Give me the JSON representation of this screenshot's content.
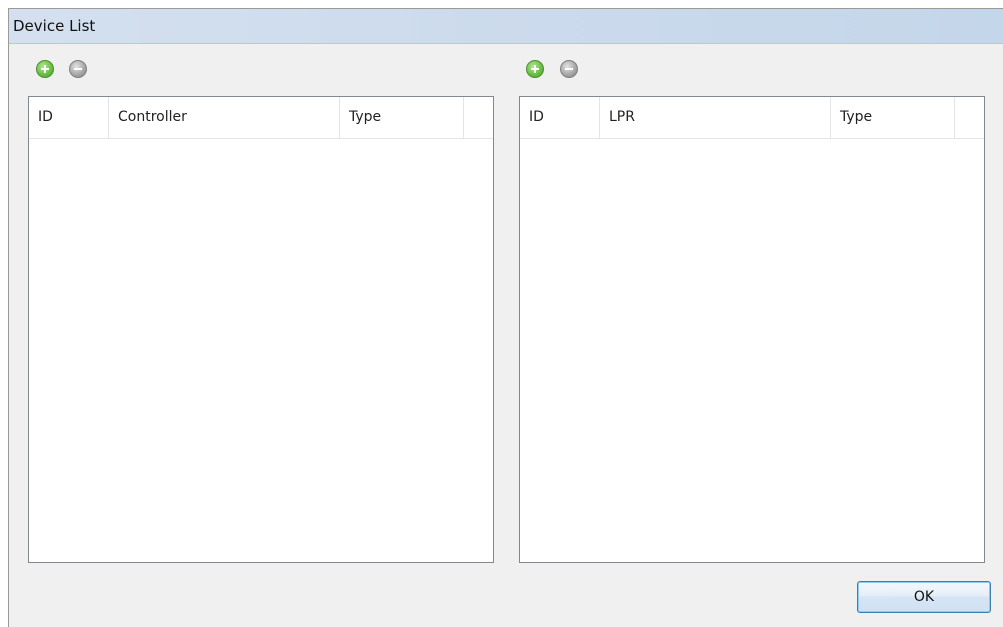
{
  "window": {
    "title": "Device List"
  },
  "left_panel": {
    "columns": [
      "ID",
      "Controller",
      "Type"
    ],
    "rows": []
  },
  "right_panel": {
    "columns": [
      "ID",
      "LPR",
      "Type"
    ],
    "rows": []
  },
  "icons": {
    "add": "add-circle-icon",
    "remove": "remove-circle-icon"
  },
  "colors": {
    "title_bar": "#cbdaec",
    "add_icon": "#6cc045",
    "remove_icon": "#a9a9a9",
    "button_border": "#3c7fb1"
  },
  "buttons": {
    "ok_label": "OK"
  }
}
